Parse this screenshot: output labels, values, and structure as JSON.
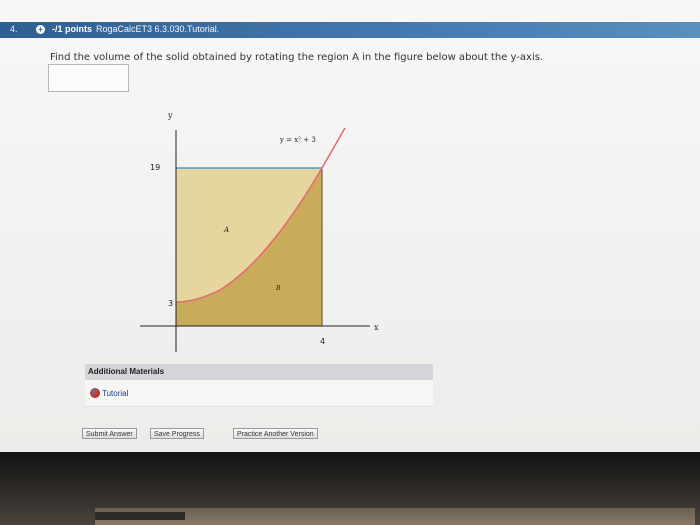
{
  "question": {
    "number": "4.",
    "status_icon": "plus-circle-icon",
    "points": "-/1 points",
    "source": "RogaCalcET3 6.3.030.Tutorial.",
    "prompt_text": "Find the volume of the solid obtained by rotating the region A in the figure below about the y-axis.",
    "answer_value": ""
  },
  "figure": {
    "y_axis_label": "y",
    "x_axis_label": "x",
    "curve_label": "y = x² + 3",
    "y_tick_top": "19",
    "y_tick_low": "3",
    "x_tick": "4",
    "region_a_label": "A",
    "region_b_label": "B",
    "colors": {
      "region_a_fill": "#e6d59e",
      "region_b_fill": "#c9ab5c",
      "curve": "#e26a6a",
      "top_line": "#4d9ad6",
      "axes": "#222222"
    }
  },
  "additional_materials": {
    "title": "Additional Materials",
    "tutorial_label": "Tutorial",
    "tutorial_icon": "tutorial-icon"
  },
  "buttons": {
    "submit": "Submit Answer",
    "save": "Save Progress",
    "practice": "Practice Another Version"
  }
}
